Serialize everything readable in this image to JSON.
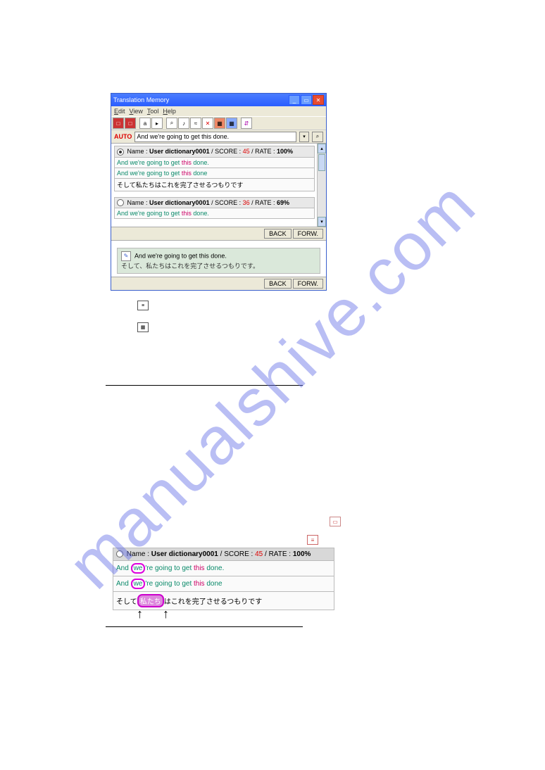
{
  "window": {
    "title": "Translation Memory",
    "menu": {
      "edit": "Edit",
      "view": "View",
      "tool": "Tool",
      "help": "Help"
    },
    "auto_label": "AUTO",
    "search_text": "And we're going to get this done."
  },
  "results": [
    {
      "selected": true,
      "name_label": "Name :",
      "name": "User dictionary0001",
      "score_label": " / SCORE :",
      "score": " 45",
      "rate_label": " / RATE :",
      "rate": " 100%",
      "rows": [
        {
          "tokens": [
            {
              "t": "And",
              "c": "green"
            },
            {
              "t": " we're",
              "c": "green"
            },
            {
              "t": " going",
              "c": "green"
            },
            {
              "t": " to",
              "c": "green"
            },
            {
              "t": " get",
              "c": "green"
            },
            {
              "t": " this",
              "c": "pink"
            },
            {
              "t": " done.",
              "c": "green"
            }
          ]
        },
        {
          "tokens": [
            {
              "t": "And",
              "c": "green"
            },
            {
              "t": " we're",
              "c": "green"
            },
            {
              "t": " going",
              "c": "green"
            },
            {
              "t": " to",
              "c": "green"
            },
            {
              "t": " get",
              "c": "green"
            },
            {
              "t": " this",
              "c": "pink"
            },
            {
              "t": " done",
              "c": "green"
            }
          ]
        },
        {
          "plain": "そして私たちはこれを完了させるつもりです"
        }
      ]
    },
    {
      "selected": false,
      "name_label": "Name :",
      "name": "User dictionary0001",
      "score_label": " / SCORE :",
      "score": " 36",
      "rate_label": " / RATE :",
      "rate": " 69%",
      "rows": [
        {
          "tokens": [
            {
              "t": "And",
              "c": "green"
            },
            {
              "t": " we're",
              "c": "green"
            },
            {
              "t": " going",
              "c": "green"
            },
            {
              "t": " to",
              "c": "green"
            },
            {
              "t": " get",
              "c": "green"
            },
            {
              "t": " this",
              "c": "pink"
            },
            {
              "t": " done.",
              "c": "green"
            }
          ]
        }
      ]
    }
  ],
  "nav": {
    "back": "BACK",
    "forw": "FORW."
  },
  "edit": {
    "line1": "And  we're going to get this done.",
    "line2": "そして、私たちはこれを完了させるつもりです。"
  },
  "bottom_entry": {
    "name_label": "Name :",
    "name": "User dictionary0001",
    "score_label": " / SCORE :",
    "score": " 45",
    "rate_label": " / RATE :",
    "rate": " 100%",
    "row1": {
      "pre": "And ",
      "bub": "we",
      "mid": "'re  going  to  get  ",
      "pink": "this",
      "post": "  done."
    },
    "row2": {
      "pre": "And ",
      "bub": "we",
      "mid": "'re  going  to  get  ",
      "pink": "this",
      "post": "  done"
    },
    "row3": {
      "pre": "そして",
      "bub": "私たち",
      "mid": "はこれを完了させるつもりです"
    }
  }
}
